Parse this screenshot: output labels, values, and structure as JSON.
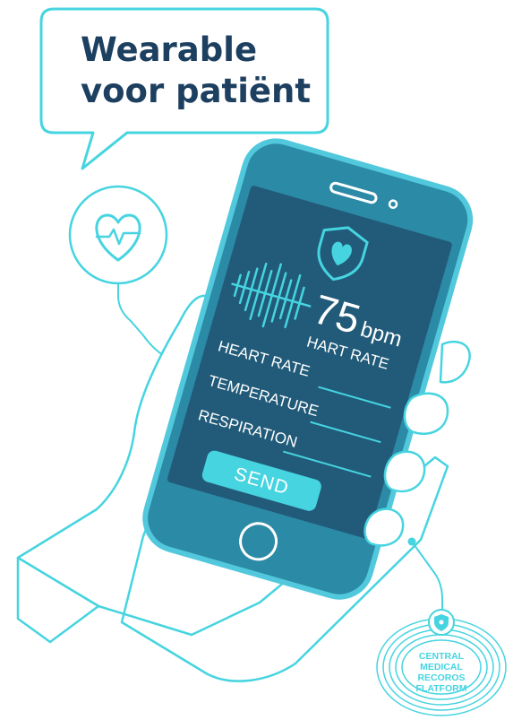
{
  "bubble": {
    "line1": "Wearable",
    "line2": "voor patiënt"
  },
  "phone": {
    "bpm_value": "75",
    "bpm_unit": "bpm",
    "bpm_caption": "HART RATE",
    "fields": [
      {
        "label": "HEART RATE"
      },
      {
        "label": "TEMPERATURE"
      },
      {
        "label": "RESPIRATION"
      }
    ],
    "send_label": "SEND"
  },
  "badge": {
    "lines": [
      "CENTRAL",
      "MEDICAL",
      "RECOROS",
      "FLATFORM"
    ]
  },
  "colors": {
    "navy": "#1d3f60",
    "cyan": "#46d4e0",
    "phone_body": "#2b8aa6",
    "phone_frame": "#52c8dc",
    "screen": "#215b79"
  },
  "icons": [
    "heart-rate-icon",
    "shield-heart-icon",
    "waveform-icon",
    "shield-icon"
  ]
}
